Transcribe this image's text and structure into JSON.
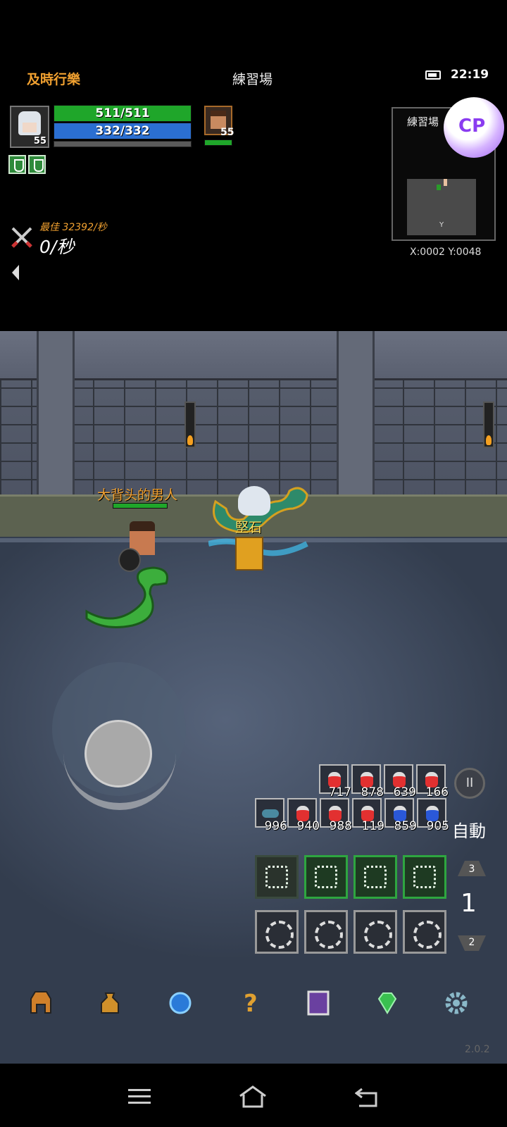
{
  "status": {
    "guild": "及時行樂",
    "map": "練習場",
    "time": "22:19"
  },
  "player": {
    "level": "55",
    "hp": "511/511",
    "mp": "332/332",
    "exp_fraction": 0.0
  },
  "pet": {
    "level": "55",
    "hp_fraction": 1.0
  },
  "dps": {
    "best": "最佳 32392/秒",
    "current": "0/秒"
  },
  "minimap": {
    "title": "練習場",
    "marker": "Y",
    "coords": "X:0002 Y:0048"
  },
  "scene": {
    "npc_name": "大背头的男人",
    "player_name": "堅石"
  },
  "potions": {
    "row1": [
      "717",
      "878",
      "639",
      "166"
    ],
    "row2": [
      "996",
      "940",
      "988",
      "119",
      "859",
      "905"
    ]
  },
  "controls": {
    "auto": "自動",
    "page": "1",
    "page_up": "3",
    "page_down": "2",
    "pause": "II"
  },
  "version": "2.0.2",
  "colors": {
    "hp": "#1fa62a",
    "mp": "#2b6fd1",
    "guild": "#f0a030",
    "skill_border": "#2ea640"
  },
  "icons": {
    "menu": [
      "helmet-icon",
      "bag-icon",
      "crystal-icon",
      "quest-icon",
      "spellbook-icon",
      "gem-icon",
      "settings-gear-icon"
    ],
    "nav": [
      "recents-icon",
      "home-icon",
      "back-icon"
    ]
  }
}
